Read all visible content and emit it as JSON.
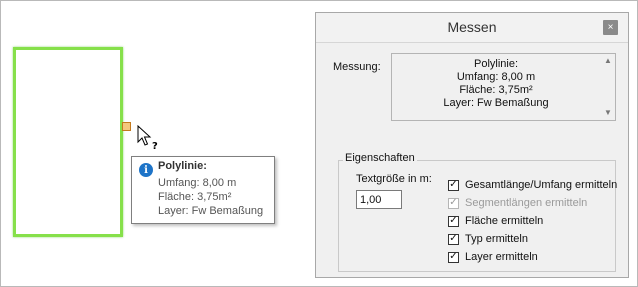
{
  "tooltip": {
    "title": "Polylinie:",
    "lines": [
      "Umfang: 8,00 m",
      "Fläche: 3,75m²",
      "Layer: Fw Bemaßung"
    ],
    "icon": "info-icon"
  },
  "panel": {
    "title": "Messen",
    "close_label": "×",
    "messung_label": "Messung:",
    "result_lines": [
      "Polylinie:",
      "Umfang: 8,00 m",
      "Fläche: 3,75m²",
      "Layer: Fw Bemaßung"
    ],
    "eigenschaften": {
      "legend": "Eigenschaften",
      "textsize_label": "Textgröße in m:",
      "textsize_value": "1,00",
      "checkboxes": [
        {
          "label": "Gesamtlänge/Umfang ermitteln",
          "checked": true,
          "disabled": false
        },
        {
          "label": "Segmentlängen ermitteln",
          "checked": true,
          "disabled": true
        },
        {
          "label": "Fläche ermitteln",
          "checked": true,
          "disabled": false
        },
        {
          "label": "Typ ermitteln",
          "checked": true,
          "disabled": false
        },
        {
          "label": "Layer ermitteln",
          "checked": true,
          "disabled": false
        }
      ]
    }
  },
  "colors": {
    "shape_outline": "#86e04a",
    "grip": "#f5c77d",
    "info": "#1e74c8"
  }
}
